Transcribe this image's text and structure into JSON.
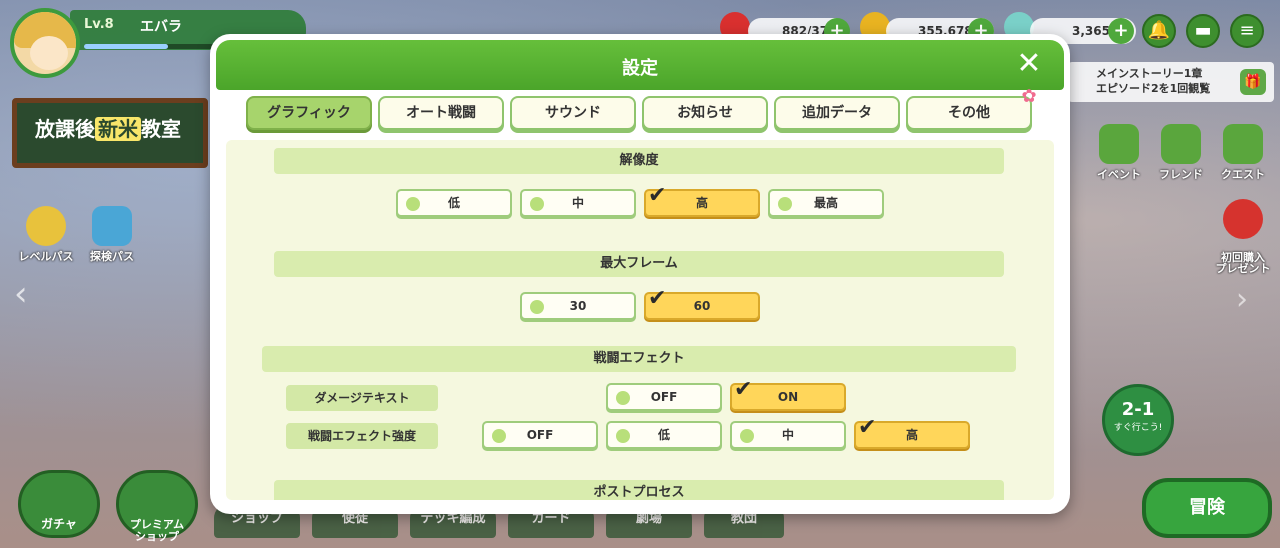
{
  "hud": {
    "level": "Lv.8",
    "name": "エバラ",
    "res1_value": "882/37",
    "res2_value": "355,678",
    "res3_value": "3,365"
  },
  "banner": {
    "line1": "メインストーリー1章",
    "line2": "エピソード2を1回観覧"
  },
  "logo": {
    "p1": "放課後",
    "p2": "新米",
    "p3": "教室"
  },
  "left_icons": {
    "pass1": "レベルパス",
    "pass2": "探検パス"
  },
  "right_icons": {
    "event": "イベント",
    "friend": "フレンド",
    "quest": "クエスト",
    "first_purchase": "初回購入\nプレゼント"
  },
  "stage": {
    "number": "2-1",
    "caption": "すぐ行こう!"
  },
  "bottom": {
    "gacha": "ガチャ",
    "premium": "プレミアム\nショップ",
    "shop": "ショップ",
    "student": "使徒",
    "deck": "デッキ編成",
    "card": "カード",
    "theater": "劇場",
    "guild": "教団",
    "adventure": "冒険"
  },
  "modal": {
    "title": "設定",
    "close": "✕",
    "tabs": [
      "グラフィック",
      "オート戦闘",
      "サウンド",
      "お知らせ",
      "追加データ",
      "その他"
    ],
    "active_tab": 0
  },
  "settings": {
    "resolution": {
      "label": "解像度",
      "options": [
        "低",
        "中",
        "高",
        "最高"
      ],
      "selected": 2
    },
    "max_frame": {
      "label": "最大フレーム",
      "options": [
        "30",
        "60"
      ],
      "selected": 1
    },
    "battle_effect": {
      "label": "戦闘エフェクト",
      "damage_text": {
        "label": "ダメージテキスト",
        "options": [
          "OFF",
          "ON"
        ],
        "selected": 1
      },
      "effect_strength": {
        "label": "戦闘エフェクト強度",
        "options": [
          "OFF",
          "低",
          "中",
          "高"
        ],
        "selected": 3
      }
    },
    "post_process": {
      "label": "ポストプロセス"
    }
  },
  "colors": {
    "header_green": "#4ba52a",
    "selected_yellow": "#ffd65a",
    "panel_bg": "#f5f8df",
    "tab_border": "#8fc46d"
  }
}
